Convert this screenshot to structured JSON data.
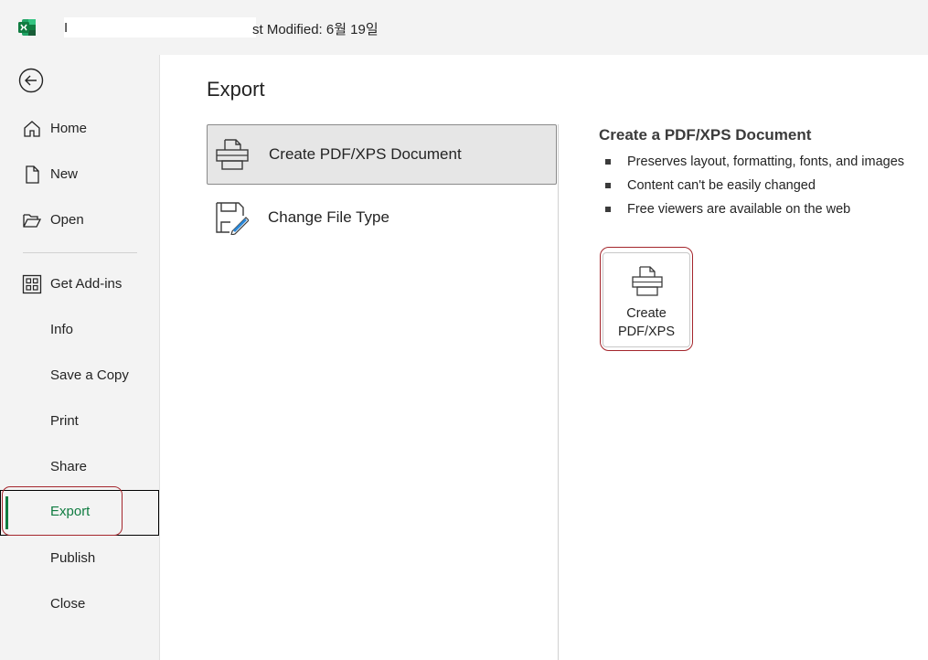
{
  "titlebar": {
    "app_icon": "excel-icon",
    "prefix": "I",
    "title": "st Modified: 6월 19일"
  },
  "sidebar": {
    "back_icon": "back-arrow-icon",
    "items": [
      {
        "label": "Home",
        "icon": "home-icon"
      },
      {
        "label": "New",
        "icon": "new-document-icon"
      },
      {
        "label": "Open",
        "icon": "folder-open-icon"
      },
      {
        "label": "Get Add-ins",
        "icon": "add-ins-grid-icon"
      },
      {
        "label": "Info"
      },
      {
        "label": "Save a Copy"
      },
      {
        "label": "Print"
      },
      {
        "label": "Share"
      },
      {
        "label": "Export"
      },
      {
        "label": "Publish"
      },
      {
        "label": "Close"
      }
    ],
    "selected": "Export",
    "accent_color": "#107c41"
  },
  "main": {
    "title": "Export",
    "options": [
      {
        "label": "Create PDF/XPS Document",
        "icon": "printer-document-icon",
        "active": true
      },
      {
        "label": "Change File Type",
        "icon": "change-file-type-icon",
        "active": false
      }
    ],
    "detail": {
      "title": "Create a PDF/XPS Document",
      "bullets": [
        "Preserves layout, formatting, fonts, and images",
        "Content can't be easily changed",
        "Free viewers are available on the web"
      ],
      "button_line1": "Create",
      "button_line2": "PDF/XPS",
      "button_icon": "printer-document-icon"
    }
  },
  "highlight_color": "#a4262c"
}
